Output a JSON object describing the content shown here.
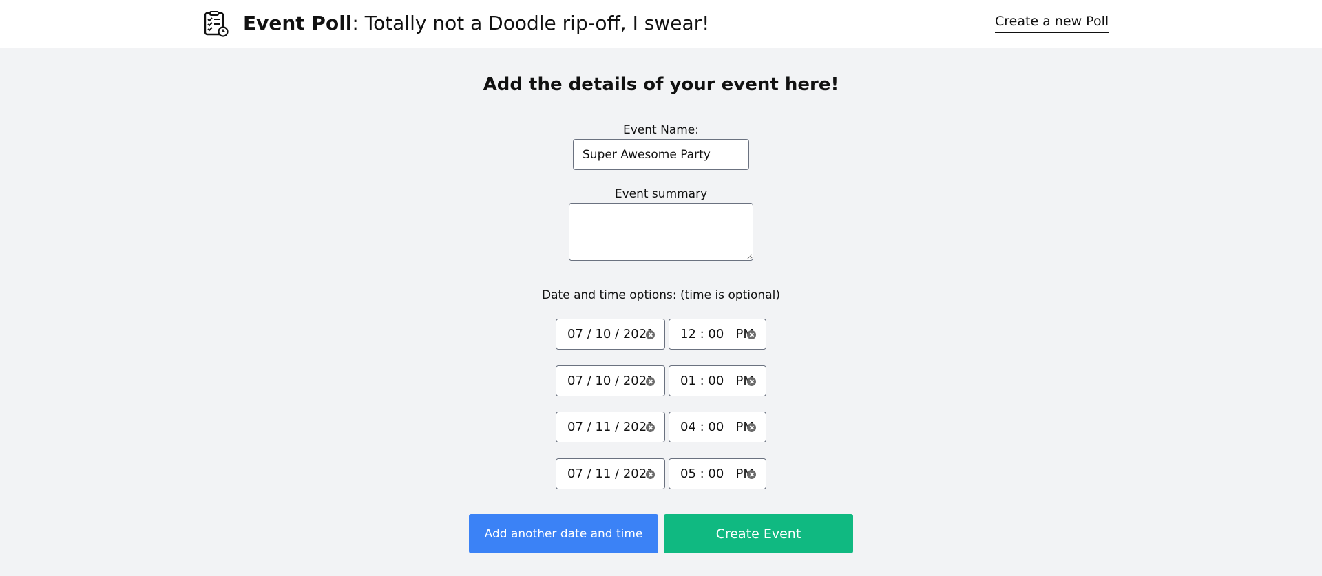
{
  "header": {
    "brand_bold": "Event Poll",
    "brand_rest": ": Totally not a Doodle rip-off, I swear!",
    "create_link": "Create a new Poll",
    "logo_icon": "checklist-clock-icon"
  },
  "form": {
    "title": "Add the details of your event here!",
    "name_label": "Event Name:",
    "name_value": "Super Awesome Party",
    "summary_label": "Event summary",
    "summary_value": "",
    "options_label": "Date and time options: (time is optional)",
    "options": [
      {
        "date": "07 / 10 / 2021",
        "time": "12 : 00   PM"
      },
      {
        "date": "07 / 10 / 2021",
        "time": "01 : 00   PM"
      },
      {
        "date": "07 / 11 / 2021",
        "time": "04 : 00   PM"
      },
      {
        "date": "07 / 11 / 2021",
        "time": "05 : 00   PM"
      }
    ],
    "add_button": "Add another date and time",
    "create_button": "Create Event"
  },
  "colors": {
    "add_button_bg": "#3b82f6",
    "create_button_bg": "#10b981",
    "page_bg": "#f2f3f5"
  }
}
